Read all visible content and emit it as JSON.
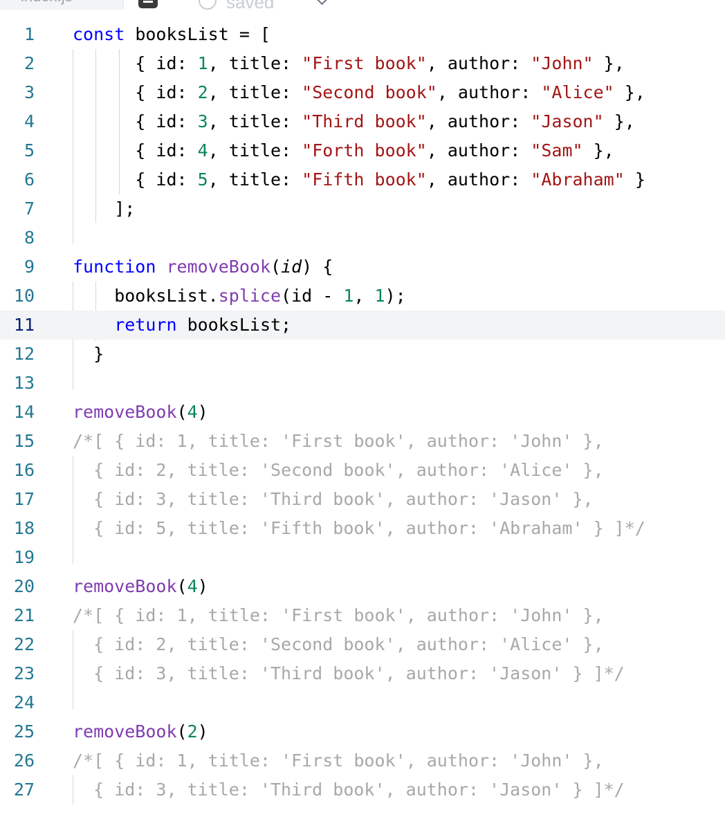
{
  "tabbar": {
    "file_tab_label": "index.js",
    "status_label": "saved"
  },
  "editor": {
    "active_line": 11,
    "lines": [
      {
        "n": "1",
        "tokens": [
          {
            "t": "const",
            "c": "kw"
          },
          {
            "t": " booksList = ["
          }
        ]
      },
      {
        "n": "2",
        "tokens": [
          {
            "t": "      { id: "
          },
          {
            "t": "1",
            "c": "num"
          },
          {
            "t": ", title: "
          },
          {
            "t": "\"First book\"",
            "c": "str"
          },
          {
            "t": ", author: "
          },
          {
            "t": "\"John\"",
            "c": "str"
          },
          {
            "t": " },"
          }
        ]
      },
      {
        "n": "3",
        "tokens": [
          {
            "t": "      { id: "
          },
          {
            "t": "2",
            "c": "num"
          },
          {
            "t": ", title: "
          },
          {
            "t": "\"Second book\"",
            "c": "str"
          },
          {
            "t": ", author: "
          },
          {
            "t": "\"Alice\"",
            "c": "str"
          },
          {
            "t": " },"
          }
        ]
      },
      {
        "n": "4",
        "tokens": [
          {
            "t": "      { id: "
          },
          {
            "t": "3",
            "c": "num"
          },
          {
            "t": ", title: "
          },
          {
            "t": "\"Third book\"",
            "c": "str"
          },
          {
            "t": ", author: "
          },
          {
            "t": "\"Jason\"",
            "c": "str"
          },
          {
            "t": " },"
          }
        ]
      },
      {
        "n": "5",
        "tokens": [
          {
            "t": "      { id: "
          },
          {
            "t": "4",
            "c": "num"
          },
          {
            "t": ", title: "
          },
          {
            "t": "\"Forth book\"",
            "c": "str"
          },
          {
            "t": ", author: "
          },
          {
            "t": "\"Sam\"",
            "c": "str"
          },
          {
            "t": " },"
          }
        ]
      },
      {
        "n": "6",
        "tokens": [
          {
            "t": "      { id: "
          },
          {
            "t": "5",
            "c": "num"
          },
          {
            "t": ", title: "
          },
          {
            "t": "\"Fifth book\"",
            "c": "str"
          },
          {
            "t": ", author: "
          },
          {
            "t": "\"Abraham\"",
            "c": "str"
          },
          {
            "t": " }"
          }
        ]
      },
      {
        "n": "7",
        "tokens": [
          {
            "t": "    ];"
          }
        ]
      },
      {
        "n": "8",
        "tokens": []
      },
      {
        "n": "9",
        "tokens": [
          {
            "t": "function",
            "c": "kw"
          },
          {
            "t": " "
          },
          {
            "t": "removeBook",
            "c": "fc"
          },
          {
            "t": "("
          },
          {
            "t": "id",
            "c": "param"
          },
          {
            "t": ") {"
          }
        ]
      },
      {
        "n": "10",
        "tokens": [
          {
            "t": "    booksList."
          },
          {
            "t": "splice",
            "c": "fc"
          },
          {
            "t": "(id - "
          },
          {
            "t": "1",
            "c": "num"
          },
          {
            "t": ", "
          },
          {
            "t": "1",
            "c": "num"
          },
          {
            "t": ");"
          }
        ]
      },
      {
        "n": "11",
        "tokens": [
          {
            "t": "    "
          },
          {
            "t": "return",
            "c": "kw"
          },
          {
            "t": " booksList;"
          }
        ]
      },
      {
        "n": "12",
        "tokens": [
          {
            "t": "  }"
          }
        ]
      },
      {
        "n": "13",
        "tokens": []
      },
      {
        "n": "14",
        "tokens": [
          {
            "t": "removeBook",
            "c": "fc"
          },
          {
            "t": "("
          },
          {
            "t": "4",
            "c": "num"
          },
          {
            "t": ")"
          }
        ]
      },
      {
        "n": "15",
        "tokens": [
          {
            "t": "/*[ { id: 1, title: 'First book', author: 'John' },",
            "c": "cmt"
          }
        ]
      },
      {
        "n": "16",
        "tokens": [
          {
            "t": "  { id: 2, title: 'Second book', author: 'Alice' },",
            "c": "cmt"
          }
        ]
      },
      {
        "n": "17",
        "tokens": [
          {
            "t": "  { id: 3, title: 'Third book', author: 'Jason' },",
            "c": "cmt"
          }
        ]
      },
      {
        "n": "18",
        "tokens": [
          {
            "t": "  { id: 5, title: 'Fifth book', author: 'Abraham' } ]*/",
            "c": "cmt"
          }
        ]
      },
      {
        "n": "19",
        "tokens": []
      },
      {
        "n": "20",
        "tokens": [
          {
            "t": "removeBook",
            "c": "fc"
          },
          {
            "t": "("
          },
          {
            "t": "4",
            "c": "num"
          },
          {
            "t": ")"
          }
        ]
      },
      {
        "n": "21",
        "tokens": [
          {
            "t": "/*[ { id: 1, title: 'First book', author: 'John' },",
            "c": "cmt"
          }
        ]
      },
      {
        "n": "22",
        "tokens": [
          {
            "t": "  { id: 2, title: 'Second book', author: 'Alice' },",
            "c": "cmt"
          }
        ]
      },
      {
        "n": "23",
        "tokens": [
          {
            "t": "  { id: 3, title: 'Third book', author: 'Jason' } ]*/",
            "c": "cmt"
          }
        ]
      },
      {
        "n": "24",
        "tokens": []
      },
      {
        "n": "25",
        "tokens": [
          {
            "t": "removeBook",
            "c": "fc"
          },
          {
            "t": "("
          },
          {
            "t": "2",
            "c": "num"
          },
          {
            "t": ")"
          }
        ]
      },
      {
        "n": "26",
        "tokens": [
          {
            "t": "/*[ { id: 1, title: 'First book', author: 'John' },",
            "c": "cmt"
          }
        ]
      },
      {
        "n": "27",
        "tokens": [
          {
            "t": "  { id: 3, title: 'Third book', author: 'Jason' } ]*/",
            "c": "cmt"
          }
        ]
      }
    ]
  }
}
